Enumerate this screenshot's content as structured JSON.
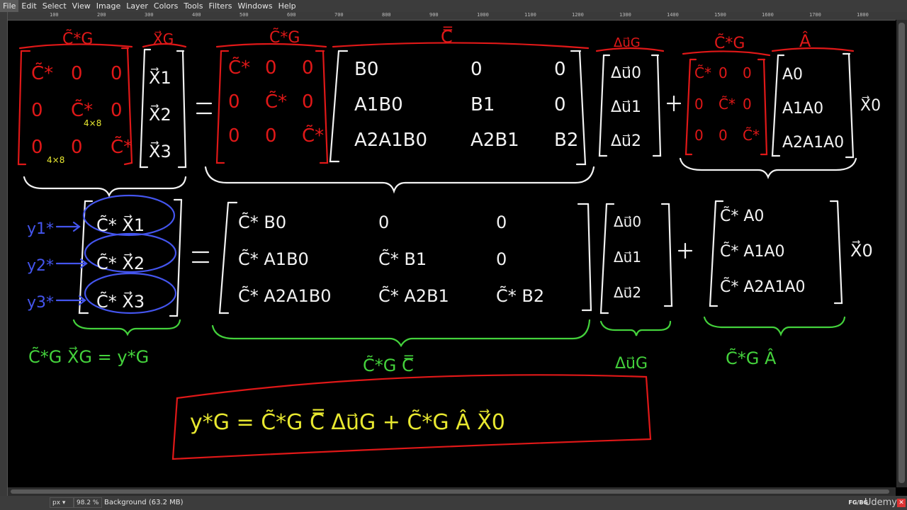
{
  "menu": [
    "File",
    "Edit",
    "Select",
    "View",
    "Image",
    "Layer",
    "Colors",
    "Tools",
    "Filters",
    "Windows",
    "Help"
  ],
  "ruler": {
    "top_marks": [
      "100",
      "200",
      "300",
      "400",
      "500",
      "600",
      "700",
      "800",
      "900",
      "1000",
      "1100",
      "1200",
      "1300",
      "1400",
      "1500",
      "1600",
      "1700",
      "1800"
    ]
  },
  "status": {
    "unit": "px",
    "zoom": "98.2 %",
    "layer_info": "Background (63.2 MB)",
    "fgbg": "FG/BG",
    "watermark": "Udemy"
  },
  "colors": {
    "red": "#e01818",
    "white": "#f2f2f2",
    "blue": "#4455ee",
    "green": "#44d23c",
    "yellow": "#e8e830"
  },
  "board": {
    "row1": {
      "label_C": "C̃*G",
      "label_X": "X⃗G",
      "label_C2": "C̃*G",
      "label_Cbar": "C̿",
      "label_dU": "Δu⃗G",
      "label_C3": "C̃*G",
      "label_A": "Â",
      "mat1": [
        "C̃*",
        "0",
        "0",
        "0",
        "C̃*",
        "0",
        "0",
        "0",
        "C̃*"
      ],
      "size1": "4×8",
      "size2": "4×8",
      "xvec": [
        "X⃗1",
        "X⃗2",
        "X⃗3"
      ],
      "mat2": [
        "C̃*",
        "0",
        "0",
        "0",
        "C̃*",
        "0",
        "0",
        "0",
        "C̃*"
      ],
      "cbar": [
        "B0",
        "0",
        "0",
        "A1B0",
        "B1",
        "0",
        "A2A1B0",
        "A2B1",
        "B2"
      ],
      "du": [
        "Δu⃗0",
        "Δu⃗1",
        "Δu⃗2"
      ],
      "mat3": [
        "C̃*",
        "0",
        "0",
        "0",
        "C̃*",
        "0",
        "0",
        "0",
        "C̃*"
      ],
      "avec": [
        "A0",
        "A1A0",
        "A2A1A0"
      ],
      "x0": "X⃗0"
    },
    "row2": {
      "ys": [
        "y1*",
        "y2*",
        "y3*"
      ],
      "cx": [
        "C̃*  X⃗1",
        "C̃*  X⃗2",
        "C̃*  X⃗3"
      ],
      "mat": [
        "C̃* B0",
        "0",
        "0",
        "C̃* A1B0",
        "C̃* B1",
        "0",
        "C̃* A2A1B0",
        "C̃* A2B1",
        "C̃* B2"
      ],
      "du": [
        "Δu⃗0",
        "Δu⃗1",
        "Δu⃗2"
      ],
      "avec": [
        "C̃* A0",
        "C̃* A1A0",
        "C̃* A2A1A0"
      ],
      "x0": "X⃗0",
      "eq_left": "C̃*G X⃗G = y*G",
      "under_mat": "C̃*G C̿",
      "under_du": "Δu⃗G",
      "under_a": "C̃*G Â"
    },
    "result": "y*G = C̃*G C̿ Δu⃗G + C̃*G Â X⃗0"
  }
}
